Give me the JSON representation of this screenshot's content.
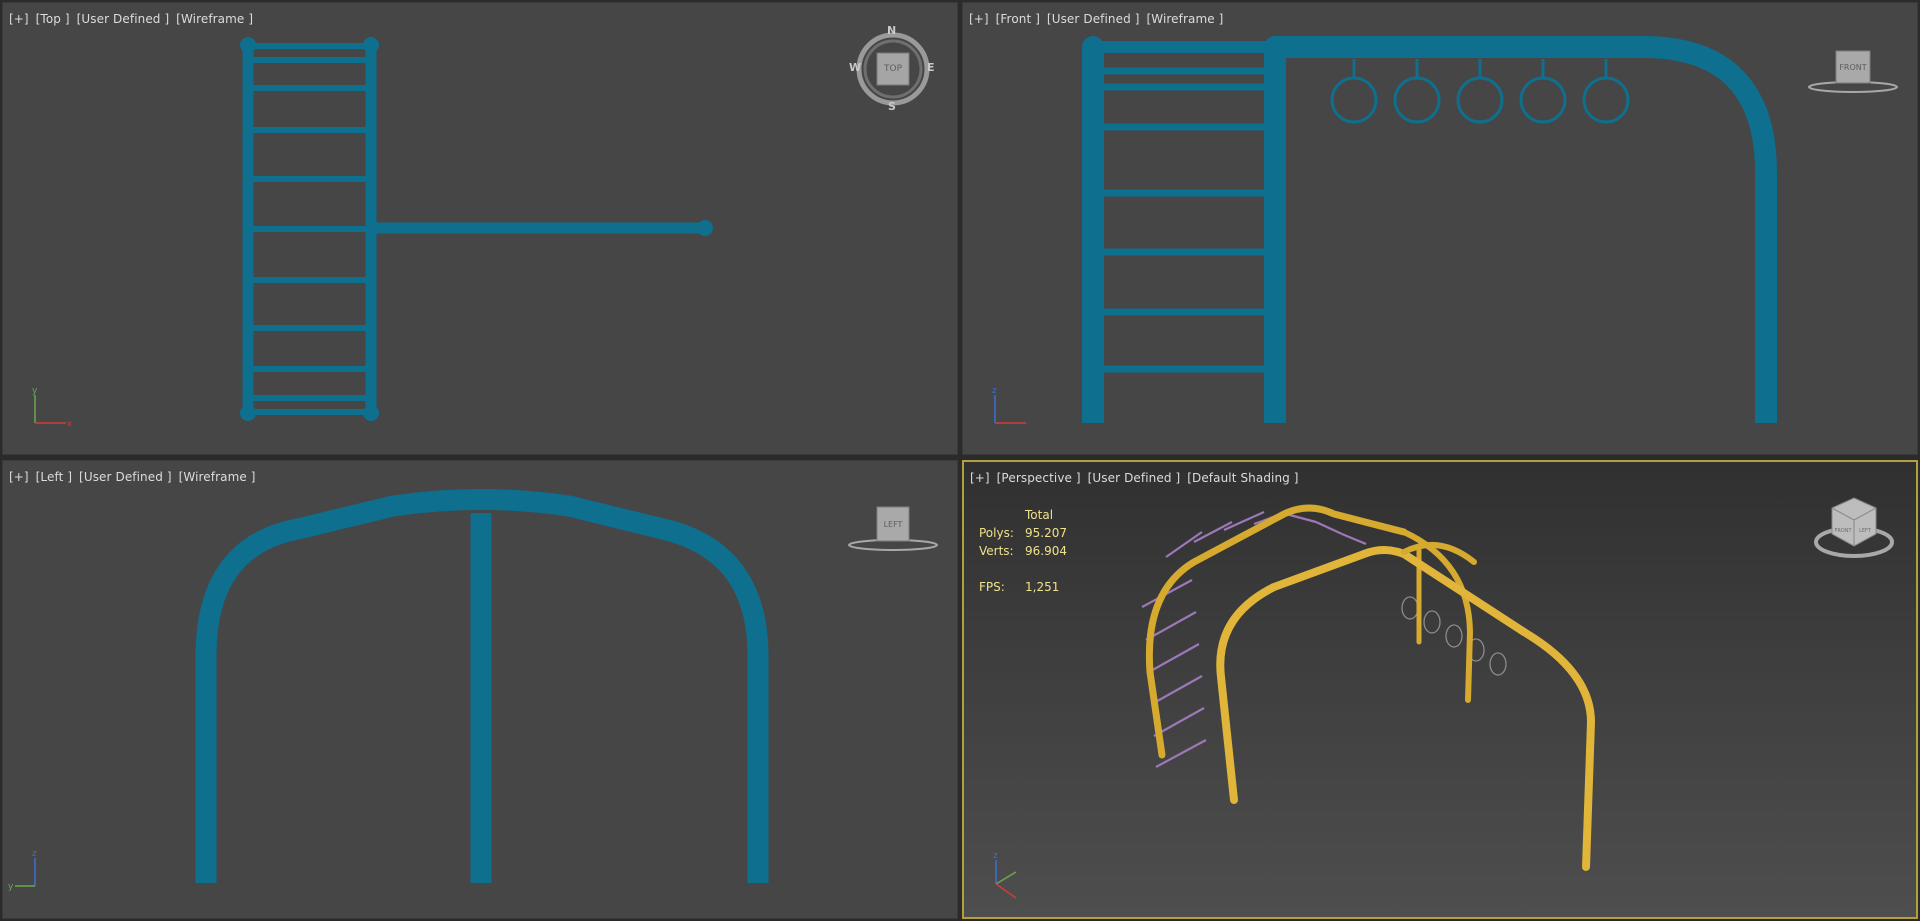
{
  "viewports": {
    "top": {
      "bracket_plus": "[+]",
      "view": "[Top ]",
      "mode": "[User Defined ]",
      "shading": "[Wireframe ]",
      "navigator": {
        "face": "TOP",
        "north": "N",
        "south": "S",
        "east": "E",
        "west": "W"
      }
    },
    "front": {
      "bracket_plus": "[+]",
      "view": "[Front ]",
      "mode": "[User Defined ]",
      "shading": "[Wireframe ]",
      "navigator": {
        "face": "FRONT"
      }
    },
    "left": {
      "bracket_plus": "[+]",
      "view": "[Left ]",
      "mode": "[User Defined ]",
      "shading": "[Wireframe ]",
      "navigator": {
        "face": "LEFT"
      }
    },
    "perspective": {
      "bracket_plus": "[+]",
      "view": "[Perspective ]",
      "mode": "[User Defined ]",
      "shading": "[Default Shading ]",
      "navigator": {
        "face_front": "FRONT",
        "face_left": "LEFT"
      }
    }
  },
  "stats": {
    "total_label": "Total",
    "polys_label": "Polys:",
    "polys_value": "95.207",
    "verts_label": "Verts:",
    "verts_value": "96.904",
    "fps_label": "FPS:",
    "fps_value": "1,251"
  },
  "colors": {
    "wireframe": "#0e6f8e",
    "tube": "#d5aa2e",
    "rung": "#9c78b8",
    "stats_text": "#f0e28a",
    "active_border": "#b59f3b",
    "viewport_bg": "#464646"
  }
}
